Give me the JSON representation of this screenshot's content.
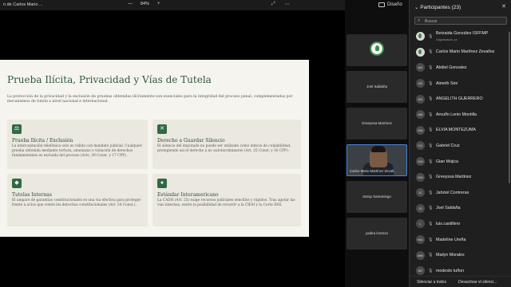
{
  "toolbar": {
    "doc_title": "n de Carlos Mario ...",
    "zoom_minus": "—",
    "zoom_level": "84%",
    "zoom_plus": "+",
    "fit_icon": "fit-page-icon",
    "more_icon": "more-icon"
  },
  "layout_button": {
    "label": "Diseño"
  },
  "slide": {
    "title": "Prueba Ilícita, Privacidad y Vías de Tutela",
    "intro": "La protección de la privacidad y la exclusión de pruebas obtenidas ilícitamente son esenciales para la integridad del proceso penal, complementadas por mecanismos de tutela a nivel nacional e internacional.",
    "cards": [
      {
        "title": "Prueba Ilícita / Exclusión",
        "body": "La interceptación telefónica solo es válida con mandato judicial. Cualquier prueba obtenida mediante tortura, amenazas o violación de derechos fundamentales es excluida del proceso (Arts. 29 Const. y 17 CPP)."
      },
      {
        "title": "Derecho a Guardar Silencio",
        "body": "El silencio del imputado no puede ser utilizado como indicio de culpabilidad, protegiendo así el derecho a no autoincriminarse (Art. 25 Const. y 16 CPP)."
      },
      {
        "title": "Tutelas Internas",
        "body": "El amparo de garantías constitucionales es una vía efectiva para proteger frente a actos que violen los derechos constitucionales (Art. 54 Const.)."
      },
      {
        "title": "Estándar Interamericano",
        "body": "La CADH (Art. 25) exige recursos judiciales sencillos y rápidos. Tras agotar las vías internas, existe la posibilidad de recurrir a la CIDH y la Corte IDH."
      }
    ]
  },
  "tiles": [
    {
      "name": "",
      "kind": "logo"
    },
    {
      "name": "Joel Saldaña",
      "kind": "name"
    },
    {
      "name": "Greeyssa Martínez",
      "kind": "name"
    },
    {
      "name": "Carlos Mario Martínez Zevall...",
      "kind": "video"
    },
    {
      "name": "Saray Samaniego",
      "kind": "name"
    },
    {
      "name": "yadira lorenzo",
      "kind": "name"
    }
  ],
  "participants": {
    "header": "Participantes (23)",
    "search_placeholder": "Buscar",
    "list": [
      {
        "initials": "",
        "name": "Betzaida González ISFFMP",
        "sub": "Organizador, yo"
      },
      {
        "initials": "",
        "name": "Carlos Mario Martínez Zevallos",
        "sub": ""
      },
      {
        "initials": "AG",
        "name": "Abdiel Gonzalez",
        "sub": ""
      },
      {
        "initials": "AS",
        "name": "Aimeth Sire",
        "sub": ""
      },
      {
        "initials": "AG",
        "name": "ANGELITH GUERRERO",
        "sub": ""
      },
      {
        "initials": "AM",
        "name": "Arnulfo Lenin Montilla",
        "sub": ""
      },
      {
        "initials": "EM",
        "name": "ELVIA MONTEZUMA",
        "sub": ""
      },
      {
        "initials": "GC",
        "name": "Gabriel Cruz",
        "sub": ""
      },
      {
        "initials": "GM",
        "name": "Gian Mojica",
        "sub": ""
      },
      {
        "initials": "GM",
        "name": "Greeyssa Martinez",
        "sub": ""
      },
      {
        "initials": "JC",
        "name": "Jahziel Contreras",
        "sub": ""
      },
      {
        "initials": "JS",
        "name": "Joel Saldaña",
        "sub": ""
      },
      {
        "initials": "L",
        "name": "luis.castillero",
        "sub": ""
      },
      {
        "initials": "MU",
        "name": "Madeline Ureña",
        "sub": ""
      },
      {
        "initials": "MM",
        "name": "Mailyn Morales",
        "sub": ""
      },
      {
        "initials": "MT",
        "name": "modesto tuñon",
        "sub": ""
      }
    ],
    "mute_all": "Silenciar a todos",
    "disable_mic": "Desactivar el silenci..."
  }
}
